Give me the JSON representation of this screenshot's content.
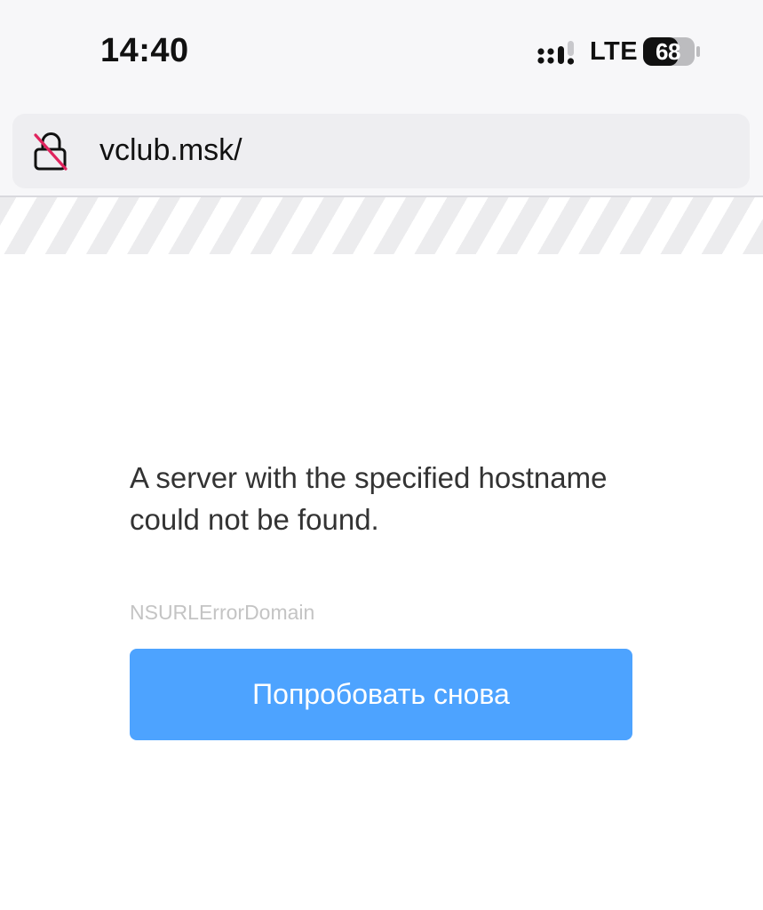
{
  "status_bar": {
    "time": "14:40",
    "network": "LTE",
    "battery_level": "68",
    "battery_fill": 0.68,
    "signal_icon": "cellular-signal-icon"
  },
  "browser": {
    "url": "vclub.msk/",
    "lock_icon": "not-secure-lock-icon"
  },
  "error_page": {
    "message": "A server with the specified hostname could not be found.",
    "domain": "NSURLErrorDomain",
    "retry_label": "Попробовать снова"
  },
  "colors": {
    "accent": "#4da3ff",
    "not_secure_slash": "#e0245e"
  }
}
